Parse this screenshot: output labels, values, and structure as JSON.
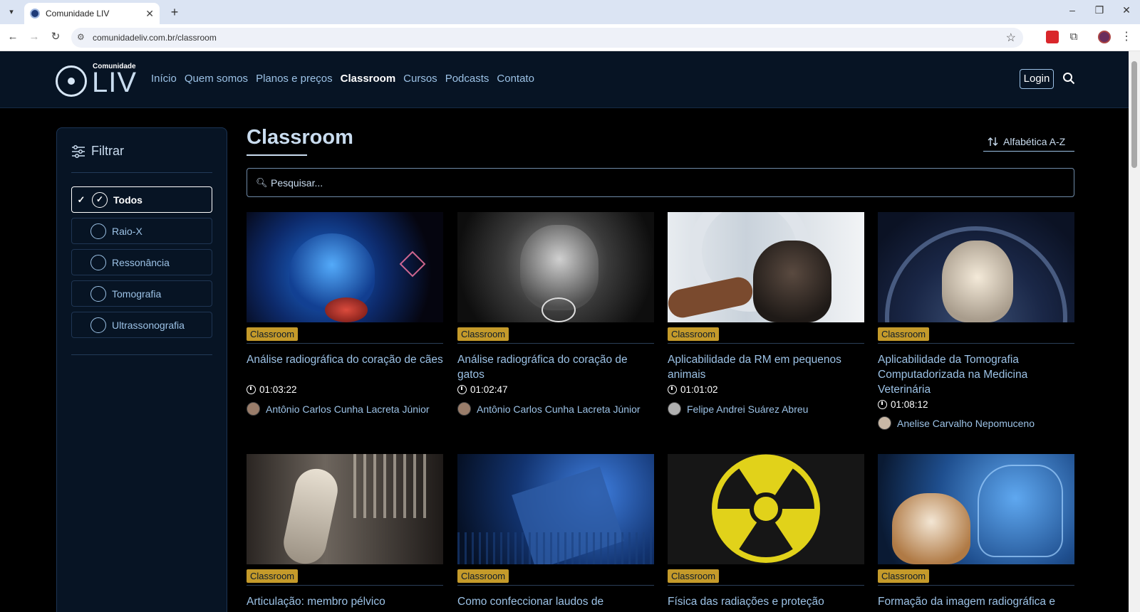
{
  "browser": {
    "tab_title": "Comunidade LIV",
    "url": "comunidadeliv.com.br/classroom"
  },
  "site": {
    "logo_small": "Comunidade",
    "logo_big": "LIV",
    "nav": [
      "Início",
      "Quem somos",
      "Planos e preços",
      "Classroom",
      "Cursos",
      "Podcasts",
      "Contato"
    ],
    "active_nav": "Classroom",
    "login": "Login"
  },
  "sidebar": {
    "title": "Filtrar",
    "items": [
      {
        "label": "Todos",
        "icon": "check-circle-icon",
        "active": true
      },
      {
        "label": "Raio-X",
        "icon": "xray-icon",
        "active": false
      },
      {
        "label": "Ressonância",
        "icon": "resonance-icon",
        "active": false
      },
      {
        "label": "Tomografia",
        "icon": "tomography-icon",
        "active": false
      },
      {
        "label": "Ultrassonografia",
        "icon": "ultrasound-icon",
        "active": false
      }
    ]
  },
  "main": {
    "title": "Classroom",
    "sort_label": "Alfabética A-Z",
    "search_placeholder": "Pesquisar..."
  },
  "cards": [
    {
      "badge": "Classroom",
      "title": "Análise radiográfica do coração de cães",
      "duration": "01:03:22",
      "author": "Antônio Carlos Cunha Lacreta Júnior"
    },
    {
      "badge": "Classroom",
      "title": "Análise radiográfica do coração de gatos",
      "duration": "01:02:47",
      "author": "Antônio Carlos Cunha Lacreta Júnior"
    },
    {
      "badge": "Classroom",
      "title": "Aplicabilidade da RM em pequenos animais",
      "duration": "01:01:02",
      "author": "Felipe Andrei Suárez Abreu"
    },
    {
      "badge": "Classroom",
      "title": "Aplicabilidade da Tomografia Computadorizada na Medicina Veterinária",
      "duration": "01:08:12",
      "author": "Anelise Carvalho Nepomuceno"
    },
    {
      "badge": "Classroom",
      "title": "Articulação: membro pélvico",
      "duration": "",
      "author": ""
    },
    {
      "badge": "Classroom",
      "title": "Como confeccionar laudos de",
      "duration": "",
      "author": ""
    },
    {
      "badge": "Classroom",
      "title": "Física das radiações e proteção",
      "duration": "",
      "author": ""
    },
    {
      "badge": "Classroom",
      "title": "Formação da imagem radiográfica e",
      "duration": "",
      "author": ""
    }
  ],
  "colors": {
    "header_bg": "#071424",
    "accent_text": "#9cc2e6",
    "badge_bg": "#c49a2a"
  }
}
